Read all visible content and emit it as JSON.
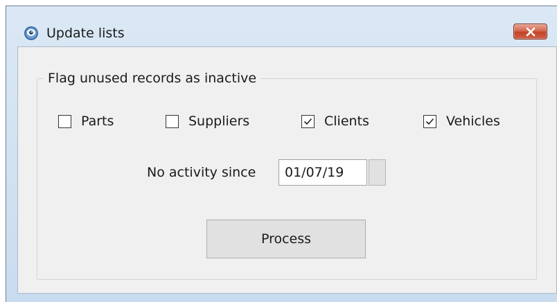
{
  "window": {
    "title": "Update lists",
    "app_icon": "eye-icon",
    "close_icon": "close-icon"
  },
  "group": {
    "label": "Flag unused records as inactive"
  },
  "checkboxes": [
    {
      "label": "Parts",
      "checked": false
    },
    {
      "label": "Suppliers",
      "checked": false
    },
    {
      "label": "Clients",
      "checked": true
    },
    {
      "label": "Vehicles",
      "checked": true
    }
  ],
  "date": {
    "label": "No activity since",
    "value": "01/07/19"
  },
  "actions": {
    "process_label": "Process"
  },
  "colors": {
    "frame": "#c9dcef",
    "client": "#f0f0f0",
    "close_button": "#c3442a",
    "button_face": "#e1e1e1"
  }
}
